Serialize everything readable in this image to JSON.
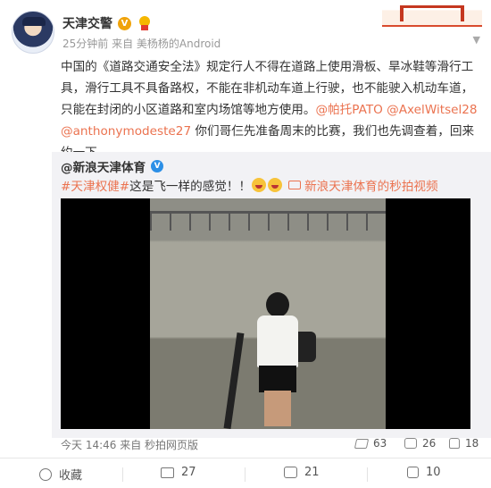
{
  "header": {
    "user_name": "天津交警",
    "verified_badge": "V",
    "meta": "25分钟前 来自 美杨杨的Android"
  },
  "post": {
    "text_main": "中国的《道路交通安全法》规定行人不得在道路上使用滑板、旱冰鞋等滑行工具，滑行工具不具备路权，不能在非机动车道上行驶，也不能驶入机动车道，只能在封闭的小区道路和室内场馆等地方使用。",
    "mention1": "@帕托PATO",
    "mention2": "@AxelWitsel28",
    "mention3": "@anthonymodeste27",
    "text_end": " 你们哥仨先准备周末的比赛，我们也先调查着，回来约一下。"
  },
  "repost": {
    "author": "@新浪天津体育",
    "verified_badge": "V",
    "topic": "#天津权健#",
    "text": " 这是飞一样的感觉！！",
    "video_link": "新浪天津体育的秒拍视频",
    "time_info": "今天 14:46 来自 秒拍网页版",
    "shares": "63",
    "comments": "26",
    "likes": "18"
  },
  "actions": {
    "favorite": "收藏",
    "repost": "27",
    "comment": "21",
    "like": "10"
  },
  "icons": [
    "award-icon",
    "chevron-down-icon",
    "share-icon",
    "comment-icon",
    "like-icon",
    "favorite-icon",
    "repost-icon",
    "video-link-icon"
  ],
  "colors": {
    "mention": "#eb7350",
    "repost_bg": "#f2f2f5",
    "verified_gold": "#f0a30a",
    "verified_blue": "#2c8fe6"
  }
}
